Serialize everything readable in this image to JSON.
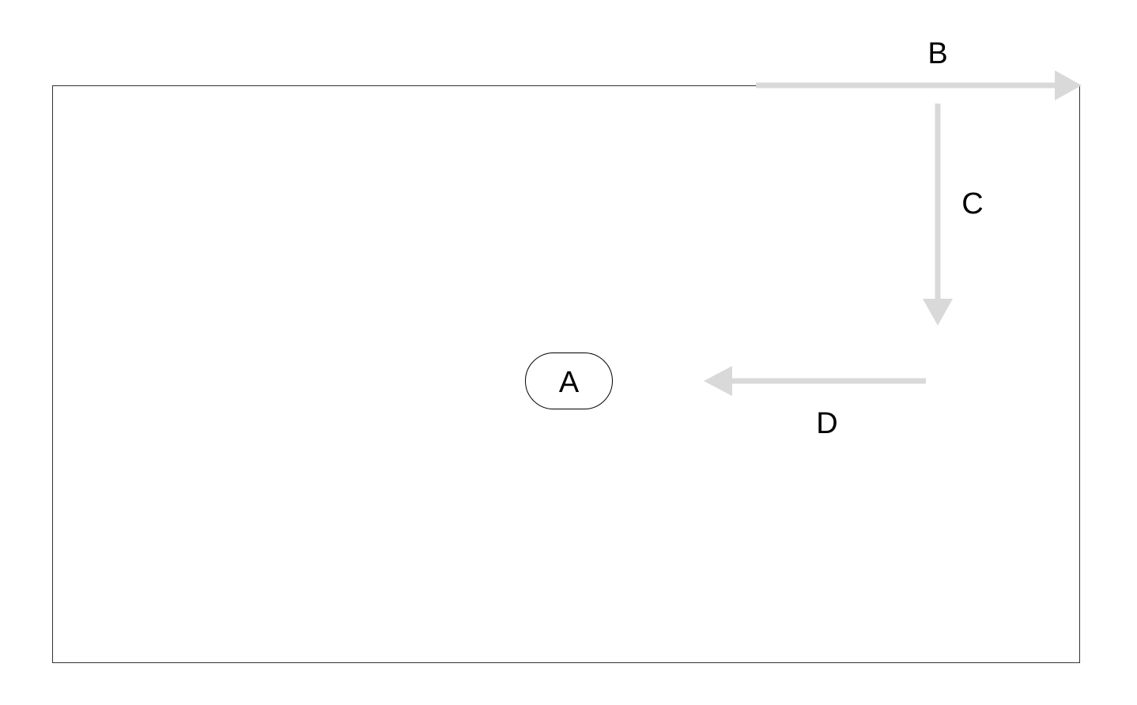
{
  "diagram": {
    "node": {
      "label": "A"
    },
    "arrows": [
      {
        "id": "b",
        "label": "B",
        "direction": "right"
      },
      {
        "id": "c",
        "label": "C",
        "direction": "down"
      },
      {
        "id": "d",
        "label": "D",
        "direction": "left"
      }
    ]
  },
  "colors": {
    "frame_stroke": "#333333",
    "arrow": "#d9d9d9",
    "node_stroke": "#000000",
    "text": "#000000"
  }
}
